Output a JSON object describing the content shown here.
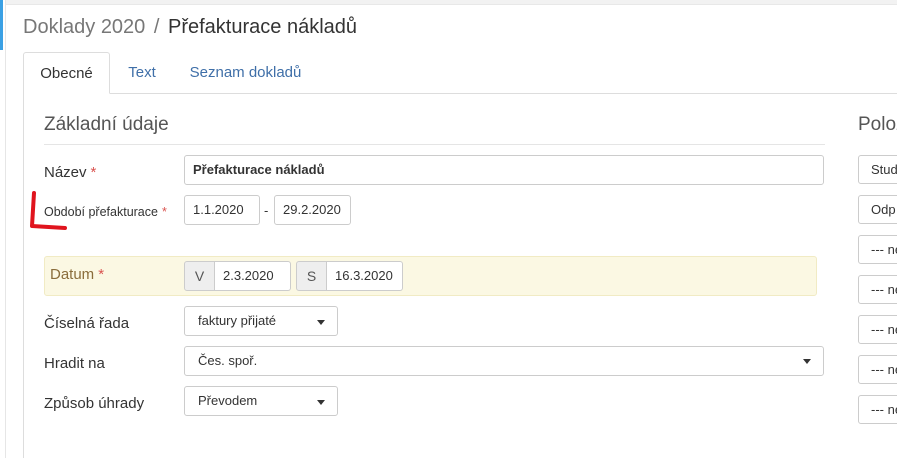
{
  "header": {
    "breadcrumb": "Doklady 2020",
    "separator": "/",
    "page_title": "Přefakturace nákladů"
  },
  "tabs": [
    {
      "label": "Obecné",
      "active": true
    },
    {
      "label": "Text",
      "active": false
    },
    {
      "label": "Seznam dokladů",
      "active": false
    }
  ],
  "basic": {
    "section_title": "Základní údaje",
    "name": {
      "label": "Název",
      "required": "*",
      "value": "Přefakturace nákladů"
    },
    "period": {
      "label": "Období přefakturace",
      "required": "*",
      "from": "1.1.2020",
      "separator": "-",
      "to": "29.2.2020"
    },
    "date": {
      "label": "Datum",
      "required": "*",
      "v_addon": "V",
      "v_value": "2.3.2020",
      "s_addon": "S",
      "s_value": "16.3.2020"
    },
    "series": {
      "label": "Číselná řada",
      "value": "faktury přijaté"
    },
    "pay_to": {
      "label": "Hradit na",
      "value": "Čes. spoř."
    },
    "payment_method": {
      "label": "Způsob úhrady",
      "value": "Převodem"
    }
  },
  "right_panel": {
    "title": "Polož",
    "items": [
      "Stud",
      "Odp",
      "--- ne",
      "--- ne",
      "--- ne",
      "--- ne",
      "--- ne"
    ]
  },
  "colors": {
    "accent": "#3aa0e4",
    "link": "#3f6fa8",
    "required": "#d9534f",
    "date_band": "#fbf8e3",
    "annotation": "#e0141e"
  },
  "icons": {
    "dropdown": "caret-down-icon",
    "annotation": "red-bracket-mark"
  }
}
